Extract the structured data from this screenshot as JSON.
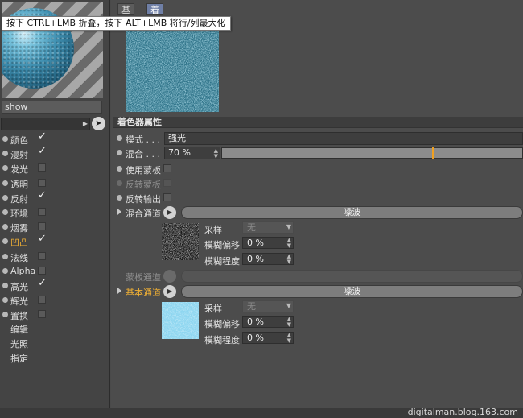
{
  "tooltip": "按下 CTRL+LMB 折叠，按下 ALT+LMB 将行/列最大化",
  "material_name": "show",
  "channels": [
    {
      "label": "颜色",
      "checked": true,
      "active": false
    },
    {
      "label": "漫射",
      "checked": true,
      "active": false
    },
    {
      "label": "发光",
      "checked": false,
      "active": false
    },
    {
      "label": "透明",
      "checked": false,
      "active": false
    },
    {
      "label": "反射",
      "checked": true,
      "active": false
    },
    {
      "label": "环境",
      "checked": false,
      "active": false
    },
    {
      "label": "烟雾",
      "checked": false,
      "active": false
    },
    {
      "label": "凹凸",
      "checked": true,
      "active": true
    },
    {
      "label": "法线",
      "checked": false,
      "active": false
    },
    {
      "label": "Alpha",
      "checked": false,
      "active": false
    },
    {
      "label": "高光",
      "checked": true,
      "active": false
    },
    {
      "label": "辉光",
      "checked": false,
      "active": false
    },
    {
      "label": "置换",
      "checked": false,
      "active": false
    }
  ],
  "sub_items": [
    "编辑",
    "光照",
    "指定"
  ],
  "check_glyph": "✓",
  "tabs": [
    "基本",
    "着色器"
  ],
  "section_title": "着色器属性",
  "mode": {
    "label": "模式",
    "dots": " . . .",
    "value": "强光"
  },
  "mix": {
    "label": "混合",
    "dots": " . . .",
    "value": "70 %",
    "percent": 70
  },
  "use_mask": {
    "label": "使用蒙板"
  },
  "invert_mask": {
    "label": "反转蒙板"
  },
  "invert_output": {
    "label": "反转输出"
  },
  "mix_channel": {
    "label": "混合通道",
    "shader": "噪波",
    "sampling_label": "采样",
    "sampling_value": "无",
    "blur_offset_label": "模糊偏移",
    "blur_offset_value": "0 %",
    "blur_scale_label": "模糊程度",
    "blur_scale_value": "0 %"
  },
  "mask_channel": {
    "label": "蒙板通道"
  },
  "base_channel": {
    "label": "基本通道",
    "shader": "噪波",
    "sampling_label": "采样",
    "sampling_value": "无",
    "blur_offset_label": "模糊偏移",
    "blur_offset_value": "0 %",
    "blur_scale_label": "模糊程度",
    "blur_scale_value": "0 %"
  },
  "watermark": "digitalman.blog.163.com",
  "icons": {
    "pick": "arrow-pick-icon",
    "play": "triangle-right-icon",
    "spin": "spinner-arrows-icon",
    "dropdown": "chevron-down-icon"
  },
  "colors": {
    "accent_orange": "#f2b134",
    "tab_active": "#6f7fa6",
    "texture_teal": "#2c7187",
    "texture_light_blue": "#8ed6f0"
  }
}
